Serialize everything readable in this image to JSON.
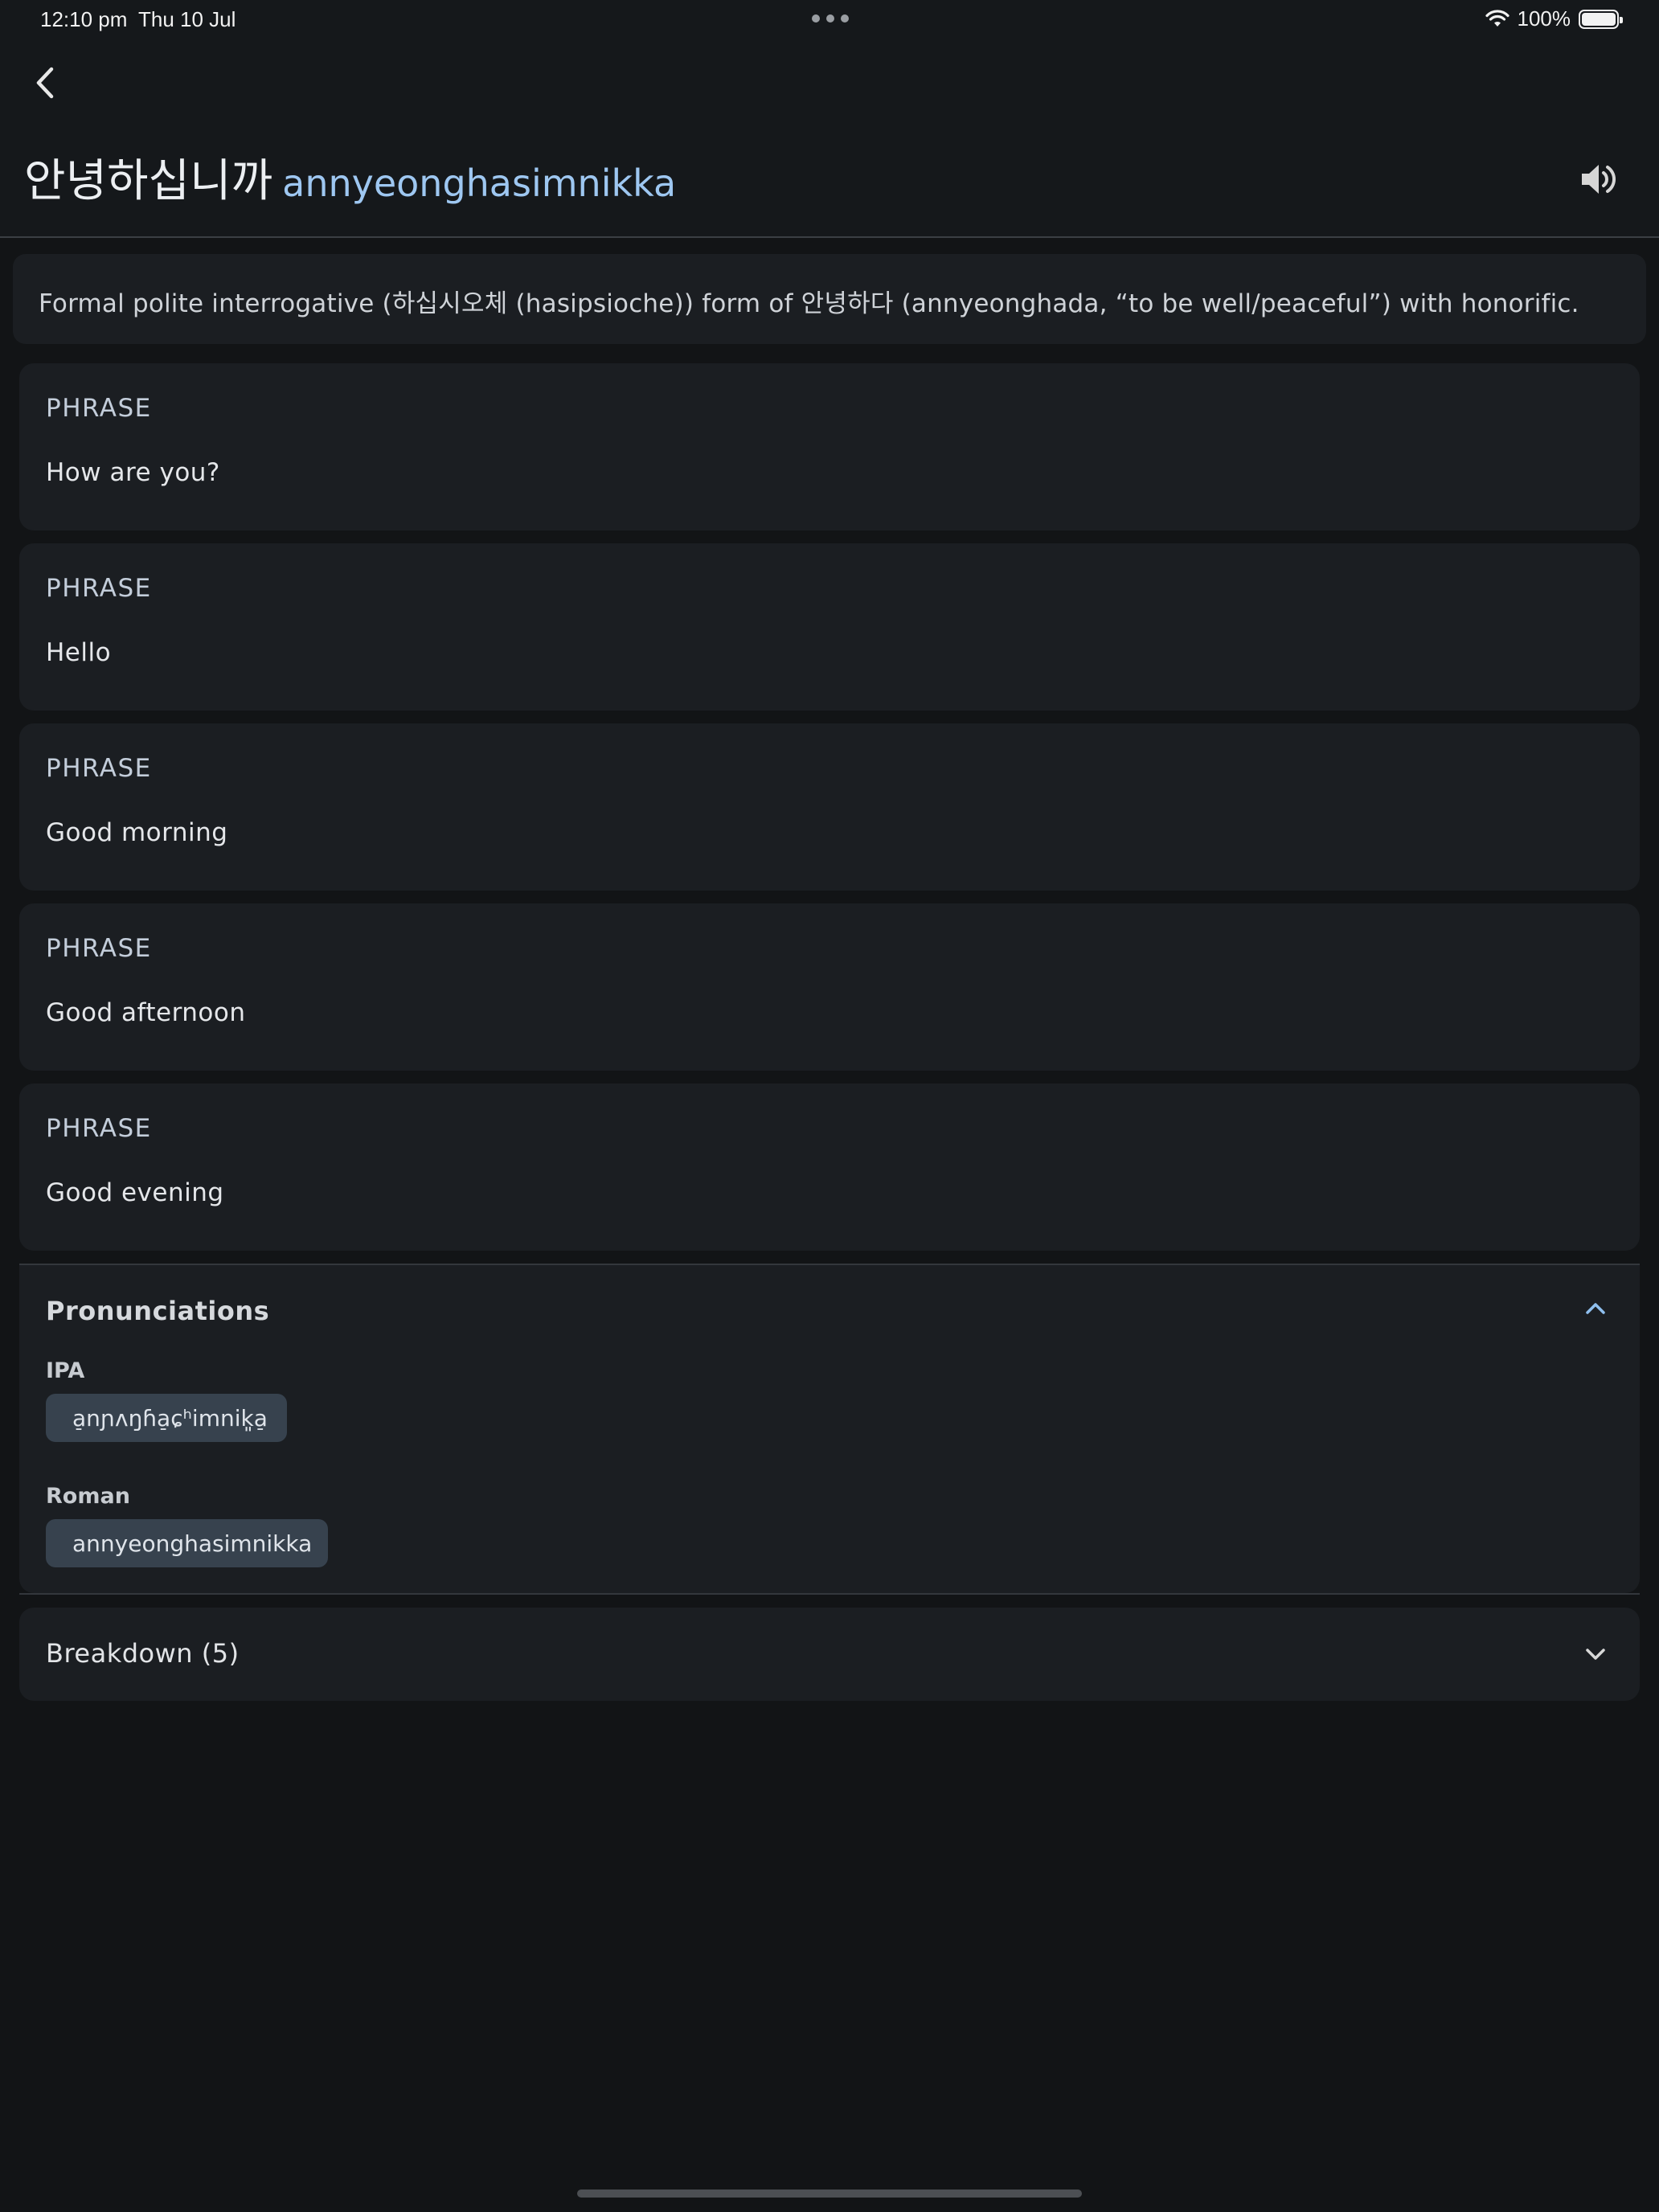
{
  "status_bar": {
    "time": "12:10 pm",
    "date": "Thu 10 Jul",
    "battery": "100%"
  },
  "header": {
    "word": "안녕하십니까",
    "romanization": "annyeonghasimnikka"
  },
  "definition": "Formal polite interrogative (하십시오체 (hasipsioche)) form of 안녕하다 (annyeonghada, “to be well/peaceful”) with honorific.",
  "phrases": [
    {
      "pos": "PHRASE",
      "gloss": "How are you?"
    },
    {
      "pos": "PHRASE",
      "gloss": "Hello"
    },
    {
      "pos": "PHRASE",
      "gloss": "Good morning"
    },
    {
      "pos": "PHRASE",
      "gloss": "Good afternoon"
    },
    {
      "pos": "PHRASE",
      "gloss": "Good evening"
    }
  ],
  "pronunciations": {
    "title": "Pronunciations",
    "ipa_label": "IPA",
    "ipa_value": "a̠nɲʌŋɦa̠ɕʰimnik͈a̠",
    "roman_label": "Roman",
    "roman_value": "annyeonghasimnikka"
  },
  "breakdown": {
    "label": "Breakdown (5)"
  },
  "colors": {
    "background": "#121416",
    "card": "#1b1e22",
    "accent": "#9ec7f1",
    "chip": "#37424e"
  }
}
